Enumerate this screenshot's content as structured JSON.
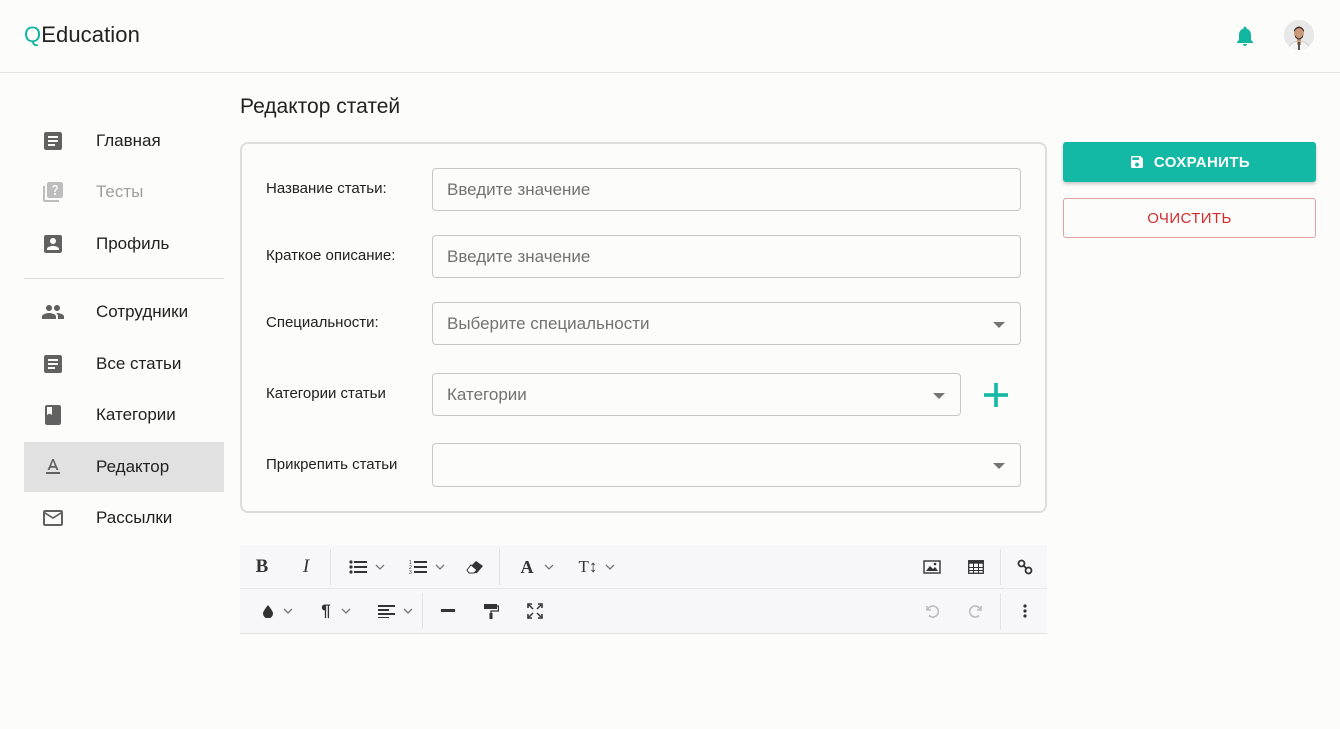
{
  "header": {
    "logo_q": "Q",
    "logo_rest": "Education",
    "accent_color": "#12b5a0"
  },
  "sidebar": {
    "items": [
      {
        "label": "Главная",
        "icon": "article-icon",
        "state": "normal"
      },
      {
        "label": "Тесты",
        "icon": "quiz-icon",
        "state": "disabled"
      },
      {
        "label": "Профиль",
        "icon": "account-box-icon",
        "state": "normal"
      },
      {
        "label": "Сотрудники",
        "icon": "people-icon",
        "state": "normal"
      },
      {
        "label": "Все статьи",
        "icon": "article-icon",
        "state": "normal"
      },
      {
        "label": "Категории",
        "icon": "book-icon",
        "state": "normal"
      },
      {
        "label": "Редактор",
        "icon": "text-format-icon",
        "state": "active"
      },
      {
        "label": "Рассылки",
        "icon": "mail-icon",
        "state": "normal"
      }
    ]
  },
  "main": {
    "title": "Редактор статей",
    "form": {
      "title_label": "Название статьи:",
      "title_placeholder": "Введите значение",
      "description_label": "Краткое описание:",
      "description_placeholder": "Введите значение",
      "specialties_label": "Специальности:",
      "specialties_placeholder": "Выберите специальности",
      "categories_label": "Категории статьи",
      "categories_placeholder": "Категории",
      "attach_label": "Прикрепить статьи",
      "attach_value": ""
    }
  },
  "actions": {
    "save_label": "СОХРАНИТЬ",
    "clear_label": "ОЧИСТИТЬ",
    "save_color": "#13b9a4",
    "clear_color": "#d02e2e"
  },
  "editor_toolbar": {
    "row1": [
      "bold-icon",
      "italic-icon",
      "bulleted-list-icon",
      "numbered-list-icon",
      "eraser-icon",
      "font-icon",
      "font-size-icon",
      "image-icon",
      "table-icon",
      "link-icon"
    ],
    "row2": [
      "color-drop-icon",
      "paragraph-icon",
      "align-icon",
      "horizontal-rule-icon",
      "format-painter-icon",
      "fullscreen-icon",
      "undo-icon",
      "redo-icon",
      "more-icon"
    ],
    "bold_glyph": "B",
    "italic_glyph": "I"
  }
}
